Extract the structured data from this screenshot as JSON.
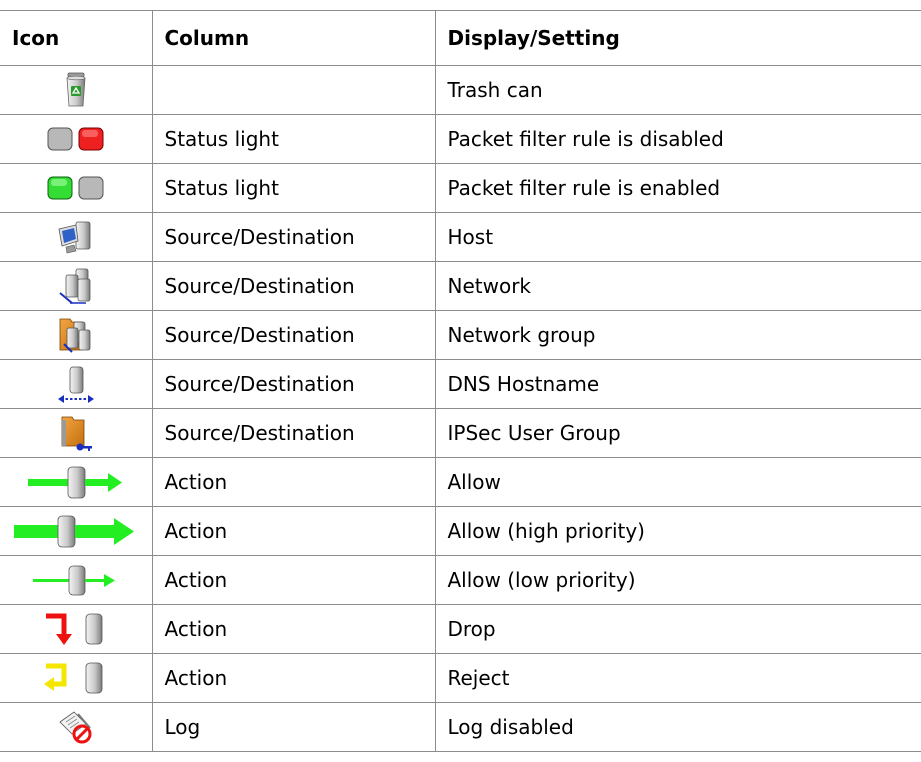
{
  "headers": {
    "icon": "Icon",
    "column": "Column",
    "display": "Display/Setting"
  },
  "rows": [
    {
      "icon": "trash-can-icon",
      "column": "",
      "display": "Trash can"
    },
    {
      "icon": "status-light-disabled-icon",
      "column": "Status light",
      "display": "Packet filter rule is disabled"
    },
    {
      "icon": "status-light-enabled-icon",
      "column": "Status light",
      "display": "Packet filter rule is enabled"
    },
    {
      "icon": "host-icon",
      "column": "Source/Destination",
      "display": "Host"
    },
    {
      "icon": "network-icon",
      "column": "Source/Destination",
      "display": "Network"
    },
    {
      "icon": "network-group-icon",
      "column": "Source/Destination",
      "display": "Network group"
    },
    {
      "icon": "dns-hostname-icon",
      "column": "Source/Destination",
      "display": "DNS Hostname"
    },
    {
      "icon": "ipsec-user-group-icon",
      "column": "Source/Destination",
      "display": "IPSec User Group"
    },
    {
      "icon": "action-allow-icon",
      "column": "Action",
      "display": "Allow"
    },
    {
      "icon": "action-allow-high-priority-icon",
      "column": "Action",
      "display": "Allow (high priority)"
    },
    {
      "icon": "action-allow-low-priority-icon",
      "column": "Action",
      "display": "Allow (low priority)"
    },
    {
      "icon": "action-drop-icon",
      "column": "Action",
      "display": "Drop"
    },
    {
      "icon": "action-reject-icon",
      "column": "Action",
      "display": "Reject"
    },
    {
      "icon": "log-disabled-icon",
      "column": "Log",
      "display": "Log disabled"
    }
  ],
  "colors": {
    "border": "#8c8c8c",
    "status_red": "#ee2020",
    "status_green": "#33dd33",
    "status_gray": "#b8b8b8",
    "arrow_green": "#22ee22",
    "arrow_red": "#ee1111",
    "arrow_yellow": "#f5e600",
    "folder_orange": "#e08a1e"
  }
}
